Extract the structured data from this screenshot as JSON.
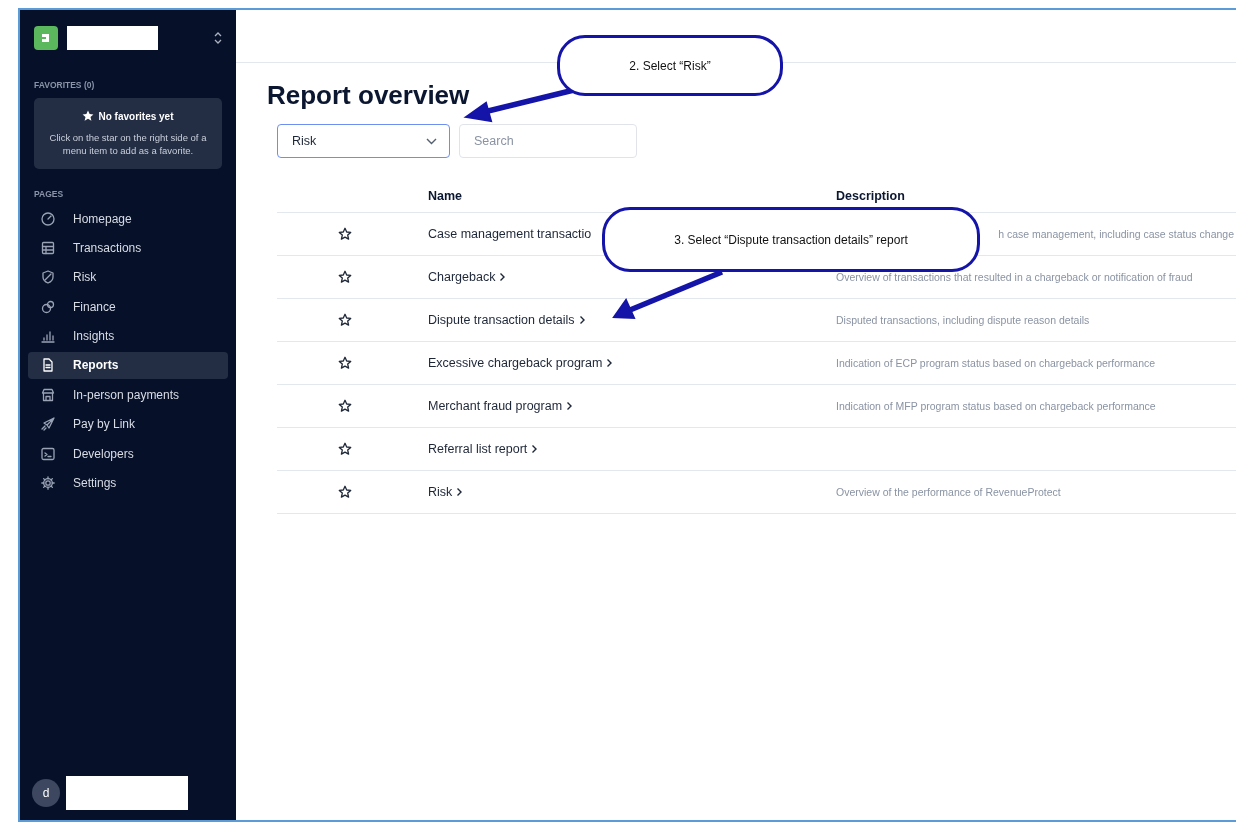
{
  "sidebar": {
    "favorites_heading": "FAVORITES (0)",
    "favorites_empty": {
      "title": "No favorites yet",
      "hint": "Click on the star on the right side of a menu item to add as a favorite."
    },
    "pages_heading": "PAGES",
    "items": [
      {
        "label": "Homepage",
        "selected": false
      },
      {
        "label": "Transactions",
        "selected": false
      },
      {
        "label": "Risk",
        "selected": false
      },
      {
        "label": "Finance",
        "selected": false
      },
      {
        "label": "Insights",
        "selected": false
      },
      {
        "label": "Reports",
        "selected": true
      },
      {
        "label": "In-person payments",
        "selected": false
      },
      {
        "label": "Pay by Link",
        "selected": false
      },
      {
        "label": "Developers",
        "selected": false
      },
      {
        "label": "Settings",
        "selected": false
      }
    ],
    "user_avatar": "d"
  },
  "page": {
    "title": "Report overview",
    "filter": {
      "value": "Risk"
    },
    "search": {
      "placeholder": "Search"
    }
  },
  "table": {
    "columns": [
      "Name",
      "Description"
    ],
    "rows": [
      {
        "name": "Case management transactio",
        "chevron": false,
        "description": "h case management, including case status change",
        "covered": true
      },
      {
        "name": "Chargeback",
        "chevron": true,
        "description": "Overview of transactions that resulted in a chargeback or notification of fraud"
      },
      {
        "name": "Dispute transaction details",
        "chevron": true,
        "description": "Disputed transactions, including dispute reason details"
      },
      {
        "name": "Excessive chargeback program",
        "chevron": true,
        "description": "Indication of ECP program status based on chargeback performance"
      },
      {
        "name": "Merchant fraud program",
        "chevron": true,
        "description": "Indication of MFP program status based on chargeback performance"
      },
      {
        "name": "Referral list report",
        "chevron": true
      },
      {
        "name": "Risk",
        "chevron": true,
        "description": "Overview of the performance of RevenueProtect"
      }
    ]
  },
  "callouts": [
    {
      "text": "2. Select “Risk”"
    },
    {
      "text": "3. Select “Dispute transaction details” report"
    }
  ]
}
